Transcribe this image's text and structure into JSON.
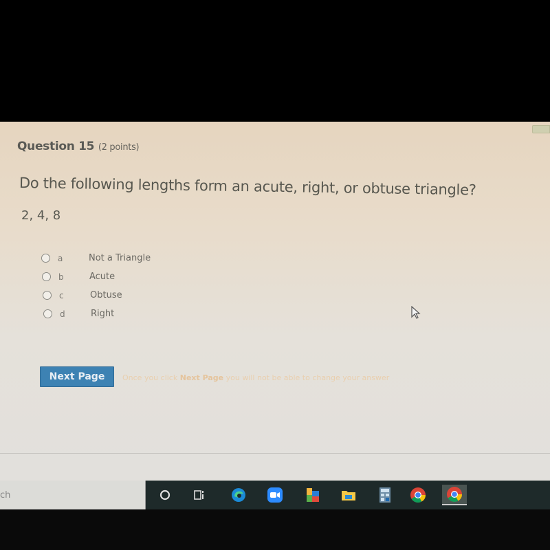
{
  "question": {
    "title": "Question 15",
    "points": "(2 points)",
    "prompt": "Do the following lengths form an acute, right, or obtuse triangle?",
    "values": "2, 4, 8",
    "options": [
      {
        "letter": "a",
        "text": "Not a Triangle",
        "selected": false
      },
      {
        "letter": "b",
        "text": "Acute",
        "selected": false
      },
      {
        "letter": "c",
        "text": "Obtuse",
        "selected": false
      },
      {
        "letter": "d",
        "text": "Right",
        "selected": false
      }
    ]
  },
  "navigation": {
    "next_label": "Next Page",
    "note_before": "Once you click ",
    "note_bold": "Next Page",
    "note_after": " you will not be able to change your answer"
  },
  "taskbar": {
    "search_text": "ch",
    "icons": [
      "cortana-icon",
      "task-view-icon",
      "edge-icon",
      "zoom-icon",
      "office-icon",
      "file-explorer-icon",
      "calculator-icon",
      "chrome-icon",
      "chrome-icon-active"
    ],
    "colors": {
      "accent_button": "#3d82b3",
      "taskbar": "#1e2a2a"
    }
  }
}
